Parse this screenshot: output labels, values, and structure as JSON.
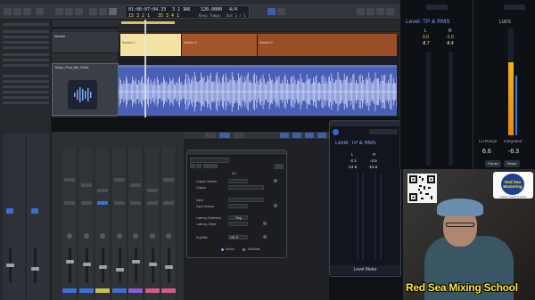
{
  "transport": {
    "position": "01:00:07:04.33",
    "bars": "3 1 1",
    "beats": "48",
    "tempo": "120.0000",
    "tempo_label": "Keep Tempo",
    "time_sig": "4/4",
    "time_sig_line2": "Out 1 / 1",
    "counter_a": "15 3 2 1",
    "counter_b": "35 3 4 1"
  },
  "arrange": {
    "track1_name": "Marker",
    "region_labels": [
      "Section 1",
      "Section 2",
      "Section 3"
    ],
    "track2_name": "Music_Final_Mix_FINAL"
  },
  "plugin": {
    "io_label": "I/O",
    "output": "Output",
    "output_vol": "Output Volume",
    "input": "Input",
    "input_vol": "Input Volume",
    "latency": "Latency Detection",
    "ping": "Ping",
    "latency_offset": "Latency Offset",
    "dry_wet": "Dry/Wet",
    "ninety": "100 %",
    "mono": "Stereo",
    "mid": "Mid/Side"
  },
  "meter": {
    "title": "Level: TP & RMS",
    "L": "L",
    "R": "R",
    "l_tp": "-2.1",
    "r_tp": "-2.5",
    "l_rms": "-14.8",
    "r_rms": "-14.6",
    "caption": "Level Meter"
  },
  "right_panel": {
    "title": "Level: TP & RMS",
    "lufs": "LUFS",
    "L": "L",
    "R": "R",
    "l_tp": "0.0",
    "r_tp": "-1.0",
    "l_rms": "-8.7",
    "r_rms": "-8.4",
    "lu_range_label": "LU Range",
    "integrated_label": "Integrated",
    "lu_range_val": "6.6",
    "integrated_val": "-6.3",
    "pause": "Pause",
    "reset": "Reset"
  },
  "webcam": {
    "logo_text": "Red Sea Mastering",
    "logo_sub": "Analog mastering studio",
    "brand": "Red Sea Mixing School"
  },
  "colors": {
    "accent_blue": "#5f7fe0",
    "region_yellow": "#f2e3a5",
    "region_orange": "#a4542a",
    "meter_blue": "#78a0ff",
    "brand_yellow": "#ffe83a"
  }
}
